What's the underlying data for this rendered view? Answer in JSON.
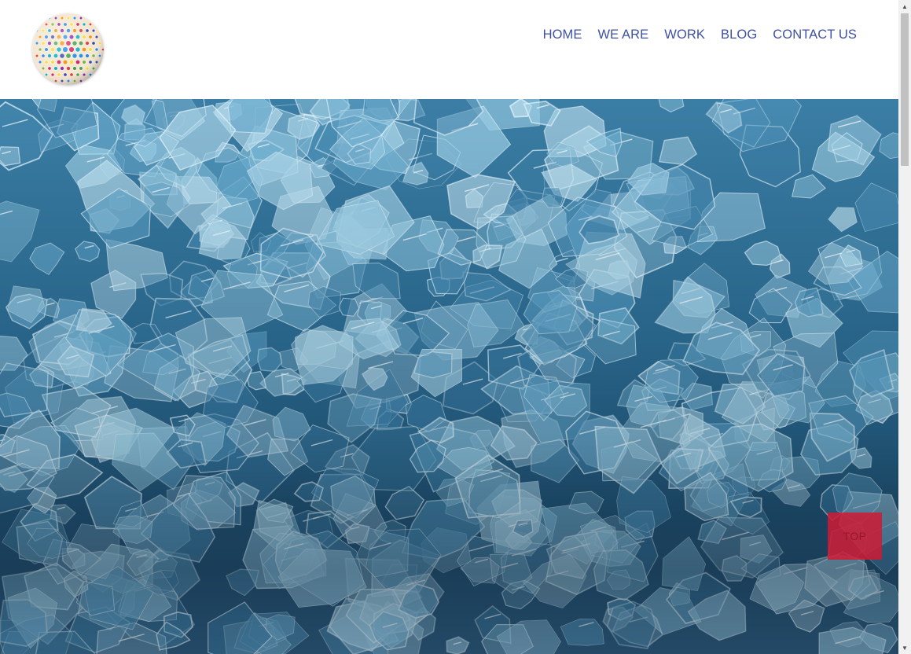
{
  "nav": {
    "items": [
      {
        "label": "HOME"
      },
      {
        "label": "WE ARE"
      },
      {
        "label": "WORK"
      },
      {
        "label": "BLOG"
      },
      {
        "label": "CONTACT US"
      }
    ]
  },
  "top_button": {
    "label": "TOP"
  },
  "colors": {
    "nav_link": "#3f51a3",
    "top_button": "#ce1a34",
    "hero_base": "#2b6a90"
  },
  "icons": {
    "logo": "colorful-icon-globe",
    "scroll_up": "triangle-up-icon",
    "scroll_down": "triangle-down-icon"
  }
}
